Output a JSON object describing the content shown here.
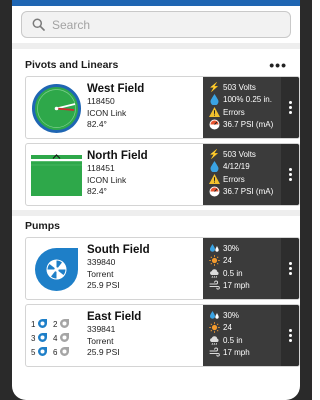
{
  "search": {
    "placeholder": "Search"
  },
  "sections": {
    "pivots": {
      "title": "Pivots and Linears"
    },
    "pumps": {
      "title": "Pumps"
    }
  },
  "pivots": [
    {
      "name": "West Field",
      "id": "118450",
      "type": "ICON Link",
      "angle": "82.4°",
      "stats": [
        "503 Volts",
        "100% 0.25 in.",
        "Errors",
        "36.7 PSI (mA)"
      ]
    },
    {
      "name": "North Field",
      "id": "118451",
      "type": "ICON Link",
      "angle": "82.4°",
      "stats": [
        "503 Volts",
        "4/12/19",
        "Errors",
        "36.7 PSI (mA)"
      ]
    }
  ],
  "pumps": [
    {
      "name": "South Field",
      "id": "339840",
      "type": "Torrent",
      "pressure": "25.9 PSI",
      "stats": [
        "30%",
        "24",
        "0.5 in",
        "17 mph"
      ]
    },
    {
      "name": "East Field",
      "id": "339841",
      "type": "Torrent",
      "pressure": "25.9 PSI",
      "pump_numbers": [
        "1",
        "2",
        "3",
        "4",
        "5",
        "6"
      ],
      "stats": [
        "30%",
        "24",
        "0.5 in",
        "17 mph"
      ]
    }
  ],
  "colors": {
    "brand_blue": "#1f66b3",
    "field_green": "#2ea84a",
    "panel_dark": "#3b3b3b",
    "pump_blue": "#1e7fc8"
  }
}
